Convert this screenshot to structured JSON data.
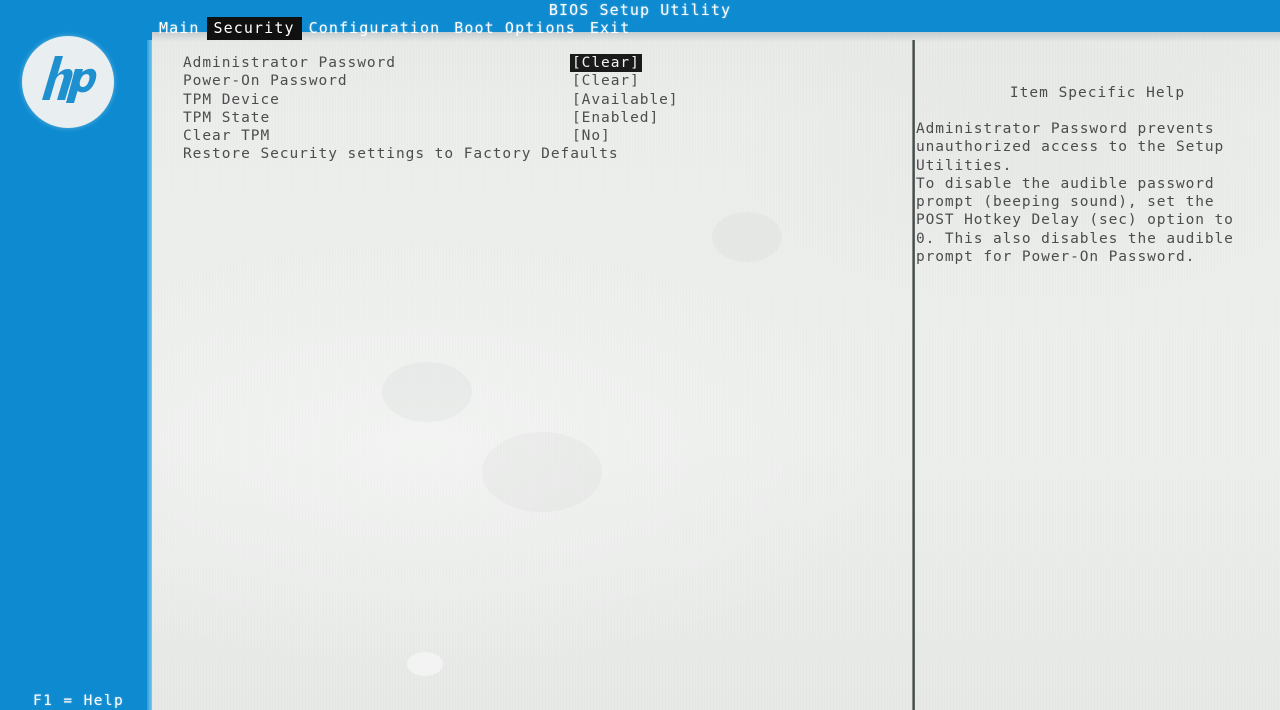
{
  "window": {
    "title": "BIOS Setup Utility",
    "brand_logo": "hp-logo"
  },
  "menubar": {
    "items": [
      {
        "label": "Main",
        "active": false
      },
      {
        "label": "Security",
        "active": true
      },
      {
        "label": "Configuration",
        "active": false
      },
      {
        "label": "Boot Options",
        "active": false
      },
      {
        "label": "Exit",
        "active": false
      }
    ]
  },
  "settings": {
    "rows": [
      {
        "label": "Administrator Password",
        "value": "[Clear]",
        "selected": true
      },
      {
        "label": "Power-On Password",
        "value": "[Clear]",
        "selected": false
      },
      {
        "label": "TPM Device",
        "value": "[Available]",
        "selected": false
      },
      {
        "label": "TPM State",
        "value": "[Enabled]",
        "selected": false
      },
      {
        "label": "Clear TPM",
        "value": "[No]",
        "selected": false
      },
      {
        "label": "Restore Security settings to Factory Defaults",
        "value": "",
        "selected": false
      }
    ]
  },
  "help": {
    "title": "Item Specific Help",
    "lines": [
      "Administrator Password prevents",
      "unauthorized access to the Setup",
      "Utilities.",
      "To disable the audible password",
      "prompt (beeping sound), set the",
      "POST Hotkey Delay (sec) option to",
      "0. This also disables the audible",
      "prompt for Power-On Password."
    ]
  },
  "footer": {
    "hint": "F1 = Help"
  },
  "colors": {
    "bezel_blue": "#0d8ad0",
    "screen_bg": "#eceeec",
    "text": "#4d4d4d",
    "selection_bg": "#1a1a1a",
    "selection_fg": "#f2f2f2",
    "title_fg": "#ffffff"
  }
}
